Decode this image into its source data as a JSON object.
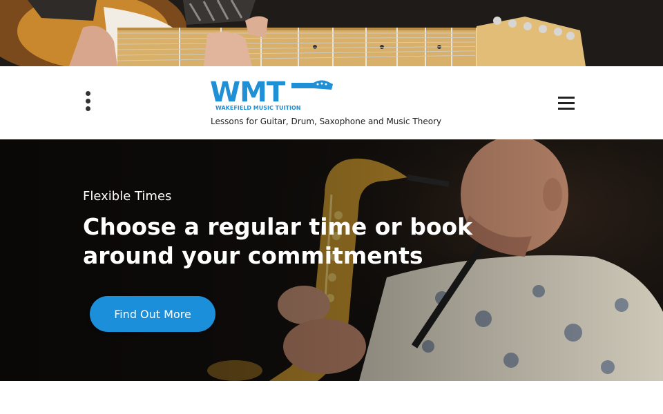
{
  "header": {
    "logo_text": "WMT",
    "logo_subtext": "WAKEFIELD MUSIC TUITION",
    "tagline": "Lessons for Guitar, Drum, Saxophone and Music Theory",
    "options_icon": "kebab-menu-icon",
    "menu_icon": "hamburger-menu-icon"
  },
  "hero": {
    "subtitle": "Flexible Times",
    "title": "Choose a regular time or book around your commitments",
    "cta_label": "Find Out More"
  },
  "colors": {
    "brand_blue": "#1f8fd6",
    "cta_blue": "#1b8fd9",
    "text_dark": "#222222"
  }
}
